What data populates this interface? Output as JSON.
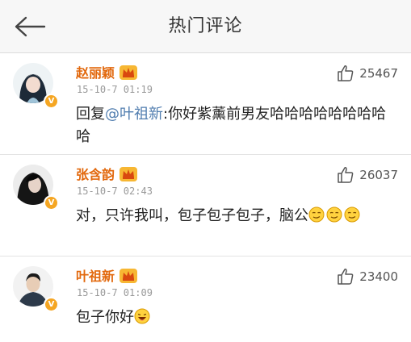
{
  "header": {
    "title": "热门评论",
    "back_icon": "back-arrow-icon"
  },
  "colors": {
    "name": "#e2680c",
    "mention": "#507daf",
    "verified": "#f5a623",
    "meta": "#999999"
  },
  "comments": [
    {
      "user": "赵丽颖",
      "time": "15-10-7 01:19",
      "likes": "25467",
      "text_prefix": "回复",
      "mention": "@叶祖新",
      "text": ":你好紫薰前男友哈哈哈哈哈哈哈哈哈",
      "emojis": []
    },
    {
      "user": "张含韵",
      "time": "15-10-7 02:43",
      "likes": "26037",
      "text_prefix": "",
      "mention": "",
      "text": "对，只许我叫，包子包子包子，脑公",
      "emojis": [
        "smirk-emoji",
        "smirk-emoji",
        "smirk-emoji"
      ]
    },
    {
      "user": "叶祖新",
      "time": "15-10-7 01:09",
      "likes": "23400",
      "text_prefix": "",
      "mention": "",
      "text": "包子你好",
      "emojis": [
        "laugh-emoji"
      ]
    }
  ]
}
